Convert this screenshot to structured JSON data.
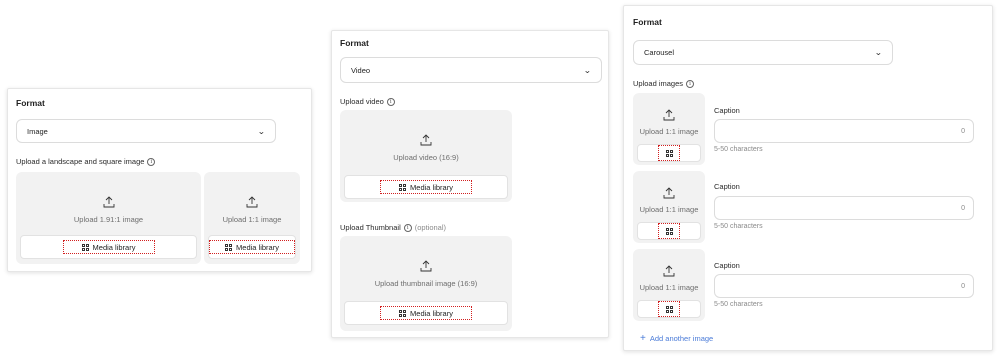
{
  "image_panel": {
    "title": "Format",
    "select_value": "Image",
    "upload_label": "Upload a landscape and square image",
    "slot_wide": {
      "text": "Upload 1.91:1 image",
      "button": "Media library"
    },
    "slot_square": {
      "text": "Upload 1:1 image",
      "button": "Media library"
    }
  },
  "video_panel": {
    "title": "Format",
    "select_value": "Video",
    "upload_label": "Upload video",
    "video_slot": {
      "text": "Upload video (16:9)",
      "button": "Media library"
    },
    "thumb_label": "Upload Thumbnail",
    "thumb_optional": "(optional)",
    "thumb_slot": {
      "text": "Upload thumbnail image (16:9)",
      "button": "Media library"
    }
  },
  "carousel_panel": {
    "title": "Format",
    "select_value": "Carousel",
    "upload_label": "Upload images",
    "items": [
      {
        "slot_text": "Upload 1:1 image",
        "caption_label": "Caption",
        "count": "0",
        "hint": "5-50 characters"
      },
      {
        "slot_text": "Upload 1:1 image",
        "caption_label": "Caption",
        "count": "0",
        "hint": "5-50 characters"
      },
      {
        "slot_text": "Upload 1:1 image",
        "caption_label": "Caption",
        "count": "0",
        "hint": "5-50 characters"
      }
    ],
    "add_label": "Add another image"
  },
  "icons": {
    "upload": "upload-icon",
    "grid": "media-grid-icon",
    "chevron": "chevron-down-icon",
    "info": "info-icon",
    "plus": "plus-icon"
  },
  "colors": {
    "highlight": "#d21f1f",
    "link": "#4a7bd8",
    "slot_bg": "#f2f2f2"
  }
}
